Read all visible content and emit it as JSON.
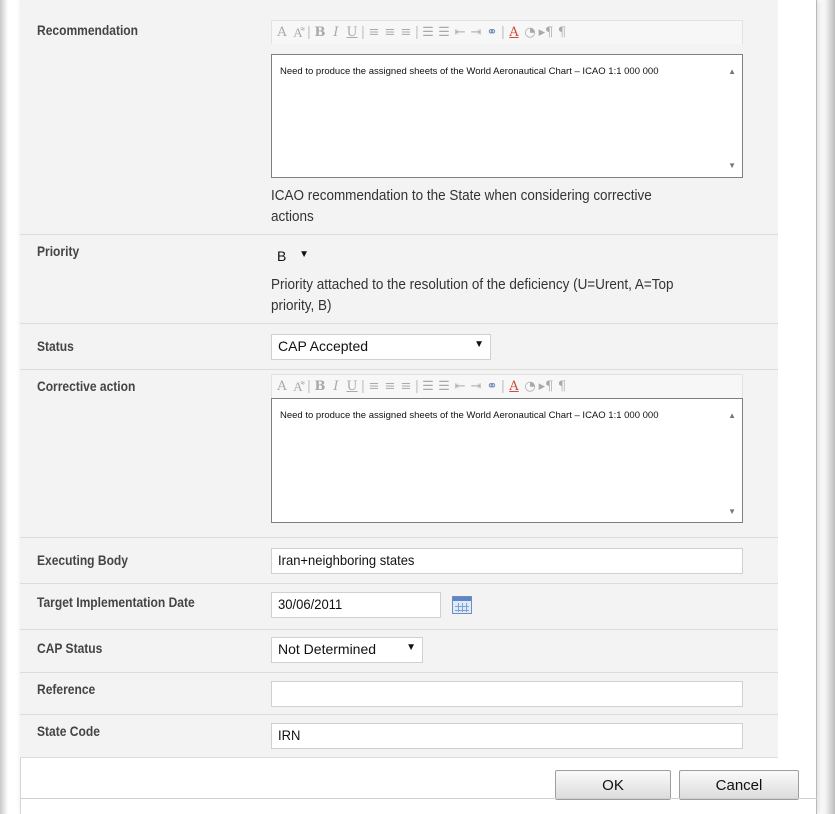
{
  "form": {
    "recommendation": {
      "label": "Recommendation",
      "text": "Need to produce the assigned sheets of the World Aeronautical Chart – ICAO 1:1 000 000",
      "help_line1": "ICAO recommendation to the State when considering corrective",
      "help_line2": "actions"
    },
    "priority": {
      "label": "Priority",
      "value": "B",
      "help_line1": "Priority attached to the resolution of the deficiency (U=Urent, A=Top",
      "help_line2": "priority, B)"
    },
    "status": {
      "label": "Status",
      "value": "CAP Accepted"
    },
    "corrective_action": {
      "label": "Corrective action",
      "text": "Need to produce the assigned sheets of the World Aeronautical Chart – ICAO 1:1 000 000"
    },
    "executing_body": {
      "label": "Executing Body",
      "value": "Iran+neighboring states"
    },
    "target_date": {
      "label": "Target Implementation Date",
      "value": "30/06/2011"
    },
    "cap_status": {
      "label": "CAP Status",
      "value": "Not Determined"
    },
    "reference": {
      "label": "Reference",
      "value": ""
    },
    "state_code": {
      "label": "State Code",
      "value": "IRN"
    }
  },
  "toolbar": {
    "icons": [
      "font-icon",
      "font-size-icon",
      "bold-icon",
      "italic-icon",
      "underline-icon",
      "align-left-icon",
      "align-center-icon",
      "align-right-icon",
      "ordered-list-icon",
      "unordered-list-icon",
      "outdent-icon",
      "indent-icon",
      "link-icon",
      "text-color-icon",
      "highlight-icon",
      "ltr-icon",
      "rtl-icon"
    ]
  },
  "buttons": {
    "ok": "OK",
    "cancel": "Cancel"
  },
  "colors": {
    "row_bg": "#f3f3f3",
    "editor_border": "#7f7f7f",
    "calendar_blue": "#5b86c9",
    "text_color_red": "#d24a3a"
  }
}
